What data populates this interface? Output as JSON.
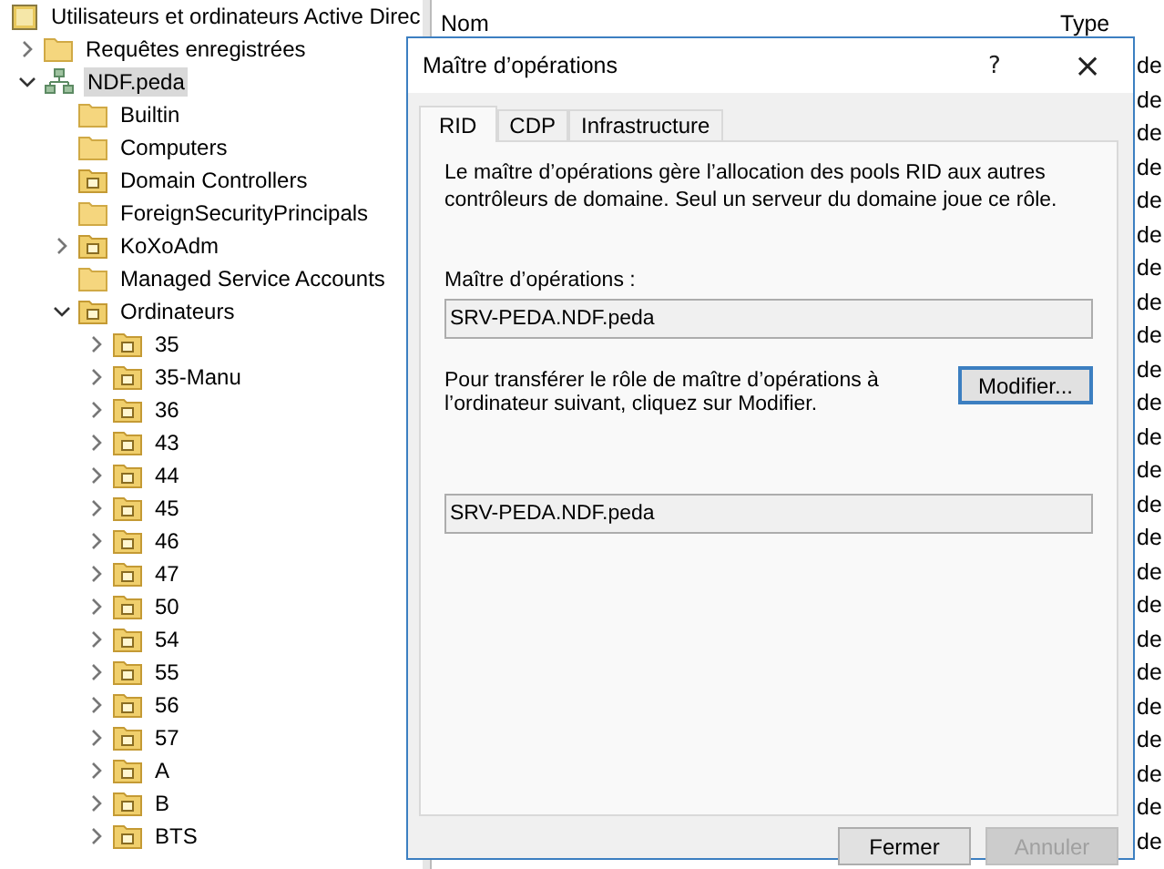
{
  "tree": {
    "label": "Utilisateurs et ordinateurs Active Direc",
    "kind": "console",
    "selected": false,
    "children": [
      {
        "label": "Requêtes enregistrées",
        "kind": "folder",
        "expanded": false,
        "selected": false
      },
      {
        "label": "NDF.peda",
        "kind": "domain",
        "expanded": true,
        "selected": true,
        "children": [
          {
            "label": "Builtin",
            "kind": "folder",
            "selected": false
          },
          {
            "label": "Computers",
            "kind": "folder",
            "selected": false
          },
          {
            "label": "Domain Controllers",
            "kind": "ou",
            "selected": false
          },
          {
            "label": "ForeignSecurityPrincipals",
            "kind": "folder",
            "selected": false
          },
          {
            "label": "KoXoAdm",
            "kind": "ou",
            "expanded": false,
            "selected": false
          },
          {
            "label": "Managed Service Accounts",
            "kind": "folder",
            "selected": false
          },
          {
            "label": "Ordinateurs",
            "kind": "ou",
            "expanded": true,
            "selected": false,
            "children": [
              {
                "label": "35",
                "kind": "ou",
                "expanded": false,
                "selected": false
              },
              {
                "label": "35-Manu",
                "kind": "ou",
                "expanded": false,
                "selected": false
              },
              {
                "label": "36",
                "kind": "ou",
                "expanded": false,
                "selected": false
              },
              {
                "label": "43",
                "kind": "ou",
                "expanded": false,
                "selected": false
              },
              {
                "label": "44",
                "kind": "ou",
                "expanded": false,
                "selected": false
              },
              {
                "label": "45",
                "kind": "ou",
                "expanded": false,
                "selected": false
              },
              {
                "label": "46",
                "kind": "ou",
                "expanded": false,
                "selected": false
              },
              {
                "label": "47",
                "kind": "ou",
                "expanded": false,
                "selected": false
              },
              {
                "label": "50",
                "kind": "ou",
                "expanded": false,
                "selected": false
              },
              {
                "label": "54",
                "kind": "ou",
                "expanded": false,
                "selected": false
              },
              {
                "label": "55",
                "kind": "ou",
                "expanded": false,
                "selected": false
              },
              {
                "label": "56",
                "kind": "ou",
                "expanded": false,
                "selected": false
              },
              {
                "label": "57",
                "kind": "ou",
                "expanded": false,
                "selected": false
              },
              {
                "label": "A",
                "kind": "ou",
                "expanded": false,
                "selected": false
              },
              {
                "label": "B",
                "kind": "ou",
                "expanded": false,
                "selected": false
              },
              {
                "label": "BTS",
                "kind": "ou",
                "expanded": false,
                "selected": false
              }
            ]
          }
        ]
      }
    ]
  },
  "list": {
    "columns": [
      "Nom",
      "Type"
    ],
    "type_cells": [
      "de",
      "de",
      "de",
      "de",
      "de",
      "de",
      "de",
      "de",
      "de",
      "de",
      "de",
      "de",
      "de",
      "de",
      "de",
      "de",
      "de",
      "de",
      "de",
      "de",
      "de",
      "de",
      "de",
      "de"
    ]
  },
  "dialog": {
    "title": "Maître d’opérations",
    "help": "?",
    "close": "×",
    "tabs": [
      {
        "label": "RID",
        "selected": true
      },
      {
        "label": "CDP",
        "selected": false
      },
      {
        "label": "Infrastructure",
        "selected": false
      }
    ],
    "description": "Le maître d’opérations gère l’allocation des pools RID aux autres contrôleurs de domaine. Seul un serveur du domaine joue ce rôle.",
    "owner_label": "Maître d’opérations :",
    "owner_value": "SRV-PEDA.NDF.peda",
    "transfer_text": "Pour transférer le rôle de maître d’opérations à l’ordinateur suivant, cliquez sur Modifier.",
    "modify_button": "Modifier...",
    "target_value": "SRV-PEDA.NDF.peda",
    "buttons": [
      {
        "label": "Fermer",
        "disabled": false
      },
      {
        "label": "Annuler",
        "disabled": true
      }
    ]
  }
}
